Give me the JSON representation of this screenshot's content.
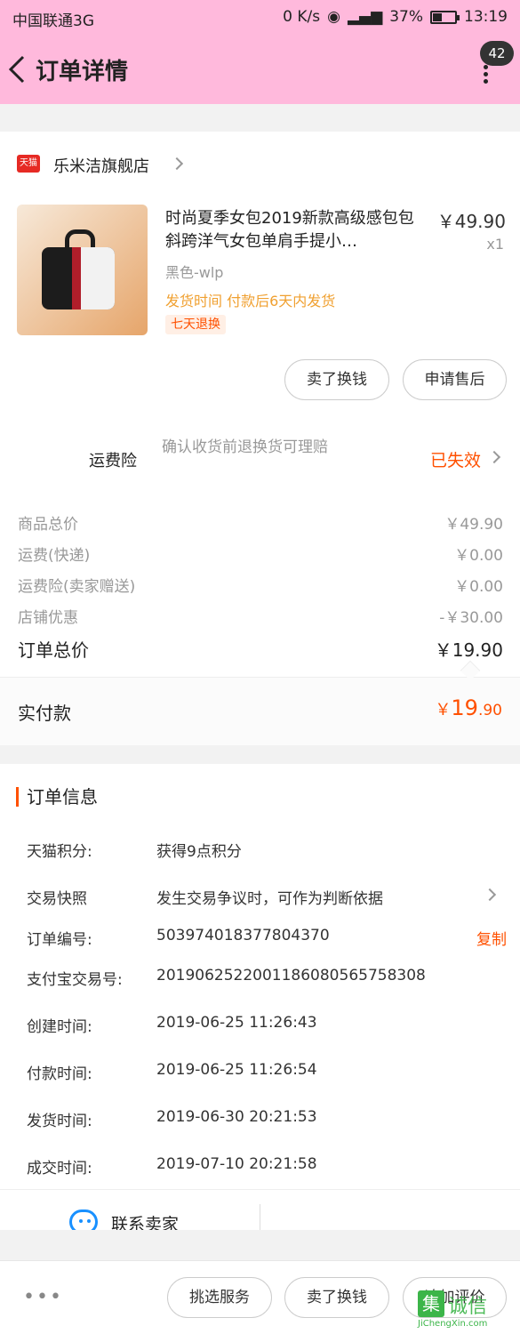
{
  "status_bar": {
    "carrier": "中国联通3G",
    "speed": "0 K/s",
    "battery": "37%",
    "time": "13:19"
  },
  "header": {
    "title": "订单详情",
    "badge": "42"
  },
  "shop": {
    "logo_text": "天猫",
    "name": "乐米洁旗舰店"
  },
  "product": {
    "title": "时尚夏季女包2019新款高级感包包斜跨洋气女包单肩手提小…",
    "price": "￥49.90",
    "qty": "x1",
    "spec": "黑色-wlp",
    "ship": "发货时间  付款后6天内发货",
    "tag": "七天退换",
    "btn_sell": "卖了换钱",
    "btn_after_sale": "申请售后"
  },
  "insurance": {
    "label": "运费险",
    "desc": "确认收货前退换货可理赔",
    "status": "已失效"
  },
  "fees": {
    "rows": [
      {
        "label": "商品总价",
        "value": "￥49.90"
      },
      {
        "label": "运费(快递)",
        "value": "￥0.00"
      },
      {
        "label": "运费险(卖家赠送)",
        "value": "￥0.00"
      },
      {
        "label": "店铺优惠",
        "value": "-￥30.00"
      }
    ],
    "total_label": "订单总价",
    "total_value": "￥19.90"
  },
  "paid": {
    "label": "实付款",
    "symbol": "￥",
    "integer": "19",
    "decimal": ".90"
  },
  "order_info": {
    "heading": "订单信息",
    "rows": [
      {
        "k": "天猫积分:",
        "v": "获得9点积分"
      },
      {
        "k": "交易快照",
        "v": "发生交易争议时，可作为判断依据"
      },
      {
        "k": "订单编号:",
        "v": "503974018377804370"
      },
      {
        "k": "支付宝交易号:",
        "v": "2019062522001186080565758308"
      },
      {
        "k": "创建时间:",
        "v": "2019-06-25 11:26:43"
      },
      {
        "k": "付款时间:",
        "v": "2019-06-25 11:26:54"
      },
      {
        "k": "发货时间:",
        "v": "2019-06-30 20:21:53"
      },
      {
        "k": "成交时间:",
        "v": "2019-07-10 20:21:58"
      }
    ],
    "copy_label": "复制"
  },
  "contact": {
    "label": "联系卖家"
  },
  "bottom_bar": {
    "more": "•••",
    "btn_service": "挑选服务",
    "btn_sell": "卖了换钱",
    "btn_review": "追加评价"
  },
  "watermark": {
    "box": "集",
    "text": "诚信",
    "sub": "JiChengXin.com"
  },
  "colors": {
    "header_bg": "#ffb9dc",
    "accent": "#ff5000",
    "ship_text": "#f0a030",
    "contact_icon": "#1890ff"
  }
}
